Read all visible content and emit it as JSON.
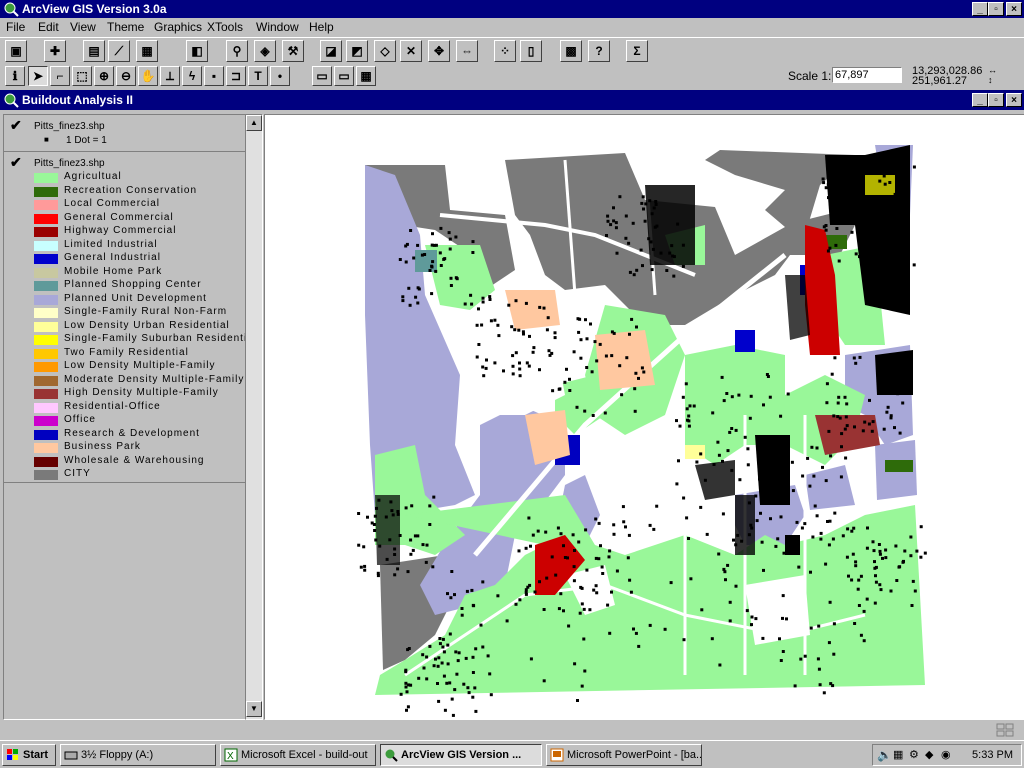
{
  "app": {
    "title": "ArcView GIS Version 3.0a",
    "menu": [
      "File",
      "Edit",
      "View",
      "Theme",
      "Graphics",
      "XTools",
      "Window",
      "Help"
    ]
  },
  "toolbar": {
    "scale_label": "Scale 1:",
    "scale_value": "67,897",
    "coord_x": "13,293,028.86",
    "coord_y": "251,961.27"
  },
  "view": {
    "title": "Buildout Analysis II"
  },
  "legend": {
    "theme1": {
      "name": "Pitts_finez3.shp",
      "item": "1 Dot = 1"
    },
    "theme2": {
      "name": "Pitts_finez3.shp",
      "items": [
        {
          "label": "Agricultual",
          "color": "#99f799"
        },
        {
          "label": "Recreation Conservation",
          "color": "#2e6b0a"
        },
        {
          "label": "Local Commercial",
          "color": "#ff9a9a"
        },
        {
          "label": "General Commercial",
          "color": "#ff0000"
        },
        {
          "label": "Highway Commercial",
          "color": "#9a0000"
        },
        {
          "label": "Limited Industrial",
          "color": "#c8ffff"
        },
        {
          "label": "General Industrial",
          "color": "#0000cc"
        },
        {
          "label": "Mobile Home Park",
          "color": "#c8c8a0"
        },
        {
          "label": "Planned Shopping Center",
          "color": "#5f9a9a"
        },
        {
          "label": "Planned Unit Development",
          "color": "#a8a8d8"
        },
        {
          "label": "Single-Family Rural Non-Farm",
          "color": "#ffffc8"
        },
        {
          "label": "Low Density Urban Residential",
          "color": "#ffff99"
        },
        {
          "label": "Single-Family Suburban Residentia",
          "color": "#ffff00"
        },
        {
          "label": "Two Family Residential",
          "color": "#ffc800"
        },
        {
          "label": "Low Density Multiple-Family",
          "color": "#ff9900"
        },
        {
          "label": "Moderate Density Multiple-Family",
          "color": "#a06830"
        },
        {
          "label": "High Density Multiple-Family",
          "color": "#993333"
        },
        {
          "label": "Residential-Office",
          "color": "#ffc8ff"
        },
        {
          "label": "Office",
          "color": "#cc00cc"
        },
        {
          "label": "Research & Development",
          "color": "#0000c0"
        },
        {
          "label": "Business Park",
          "color": "#ffc8a0"
        },
        {
          "label": "Wholesale & Warehousing",
          "color": "#660000"
        },
        {
          "label": "CITY",
          "color": "#7a7a7a"
        }
      ]
    }
  },
  "taskbar": {
    "start": "Start",
    "tasks": [
      {
        "label": "3½ Floppy (A:)"
      },
      {
        "label": "Microsoft Excel - build-out"
      },
      {
        "label": "ArcView GIS Version ..."
      },
      {
        "label": "Microsoft PowerPoint - [ba..."
      }
    ],
    "clock": "5:33 PM"
  }
}
